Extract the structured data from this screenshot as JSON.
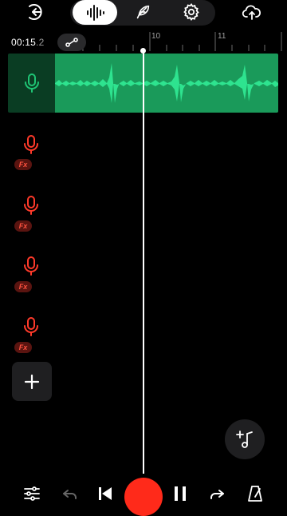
{
  "app": {
    "accent": "#1a9a5a",
    "record_color": "#ff2a1a",
    "fx_color": "#ff5240"
  },
  "top_bar": {
    "back_icon": "back-arrow-icon",
    "modes": [
      {
        "icon": "waveform-icon",
        "active": true
      },
      {
        "icon": "feather-icon",
        "active": false
      },
      {
        "icon": "gear-icon",
        "active": false
      }
    ],
    "upload_icon": "cloud-upload-icon"
  },
  "timeline": {
    "time_main": "00:15",
    "time_frac": ".2",
    "ruler_labels": [
      "10",
      "11"
    ],
    "link_icon": "link-nodes-icon"
  },
  "tracks": [
    {
      "type": "recorded",
      "mic_icon": "mic-icon",
      "color": "#1a9a5a"
    },
    {
      "type": "empty",
      "mic_icon": "mic-icon",
      "fx_label": "Fx"
    },
    {
      "type": "empty",
      "mic_icon": "mic-icon",
      "fx_label": "Fx"
    },
    {
      "type": "empty",
      "mic_icon": "mic-icon",
      "fx_label": "Fx"
    },
    {
      "type": "empty",
      "mic_icon": "mic-icon",
      "fx_label": "Fx"
    }
  ],
  "add_track": {
    "label": "+"
  },
  "bottom_bar": {
    "items": [
      "sliders-icon",
      "undo-icon",
      "skip-to-start-icon",
      "record-button",
      "pause-icon",
      "redo-icon",
      "metronome-icon"
    ]
  }
}
